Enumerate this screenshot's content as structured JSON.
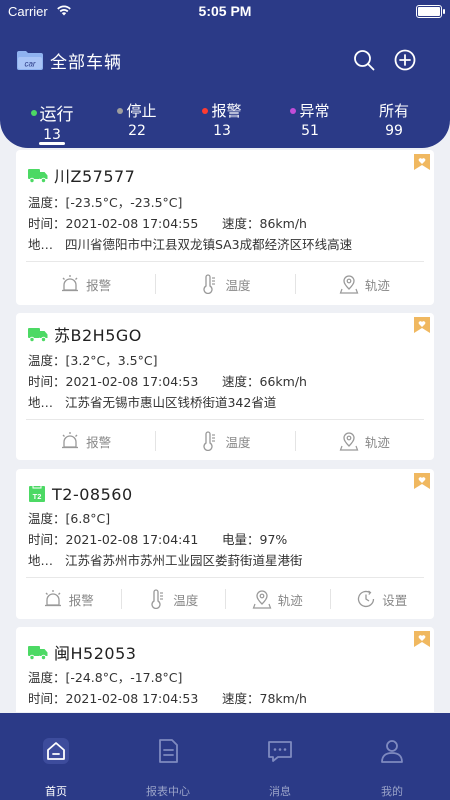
{
  "status_bar": {
    "carrier": "Carrier",
    "time": "5:05 PM"
  },
  "header": {
    "title": "全部车辆",
    "folder_badge": "car"
  },
  "tabs": [
    {
      "label": "运行",
      "count": "13",
      "dot_color": "#4cd964",
      "active": true
    },
    {
      "label": "停止",
      "count": "22",
      "dot_color": "#9e9e9e",
      "active": false
    },
    {
      "label": "报警",
      "count": "13",
      "dot_color": "#ff3b30",
      "active": false
    },
    {
      "label": "异常",
      "count": "51",
      "dot_color": "#c24dd8",
      "active": false
    },
    {
      "label": "所有",
      "count": "99",
      "dot_color": "",
      "active": false
    }
  ],
  "cards": [
    {
      "plate": "川Z57577",
      "icon": "truck-icon",
      "temp_label": "温度：",
      "temp": "[-23.5°C，-23.5°C]",
      "time_label": "时间：",
      "time": "2021-02-08 17:04:55",
      "metric_label": "速度：",
      "metric": "86km/h",
      "addr_label": "地…",
      "addr": "四川省德阳市中江县双龙镇SA3成都经济区环线高速",
      "actions": [
        "报警",
        "温度",
        "轨迹"
      ]
    },
    {
      "plate": "苏B2H5GO",
      "icon": "truck-icon",
      "temp_label": "温度：",
      "temp": "[3.2°C，3.5°C]",
      "time_label": "时间：",
      "time": "2021-02-08 17:04:53",
      "metric_label": "速度：",
      "metric": "66km/h",
      "addr_label": "地…",
      "addr": "江苏省无锡市惠山区钱桥街道342省道",
      "actions": [
        "报警",
        "温度",
        "轨迹"
      ]
    },
    {
      "plate": "T2-08560",
      "icon": "t2-icon",
      "icon_text": "T2",
      "temp_label": "温度：",
      "temp": "[6.8°C]",
      "time_label": "时间：",
      "time": "2021-02-08 17:04:41",
      "metric_label": "电量：",
      "metric": "97%",
      "addr_label": "地…",
      "addr": "江苏省苏州市苏州工业园区娄葑街道星港街",
      "actions": [
        "报警",
        "温度",
        "轨迹",
        "设置"
      ]
    },
    {
      "plate": "闽H52053",
      "icon": "truck-icon",
      "temp_label": "温度：",
      "temp": "[-24.8°C，-17.8°C]",
      "time_label": "时间：",
      "time": "2021-02-08 17:04:53",
      "metric_label": "速度：",
      "metric": "78km/h"
    }
  ],
  "tabbar": [
    {
      "label": "首页",
      "icon": "home-icon",
      "active": true
    },
    {
      "label": "报表中心",
      "icon": "report-icon",
      "active": false
    },
    {
      "label": "消息",
      "icon": "message-icon",
      "active": false
    },
    {
      "label": "我的",
      "icon": "profile-icon",
      "active": false
    }
  ],
  "colors": {
    "primary": "#2b3a87",
    "truck_green": "#4cd964",
    "bookmark": "#f0b860",
    "background": "#eef0f5"
  }
}
